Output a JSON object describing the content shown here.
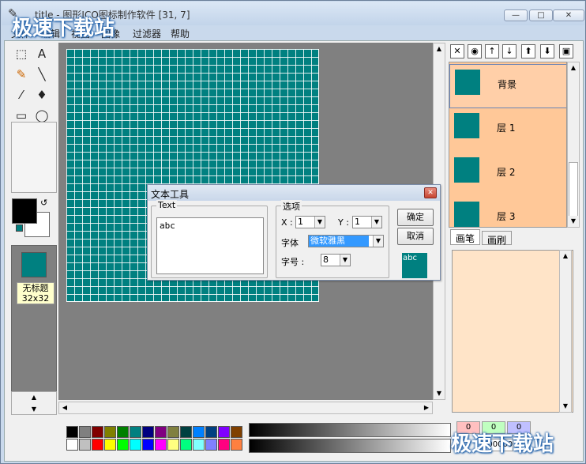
{
  "window": {
    "title": "title - 图形ICO图标制作软件 [31, 7]",
    "min_label": "—",
    "max_label": "□",
    "close_label": "✕"
  },
  "watermark": {
    "text": "极速下载站"
  },
  "menu": [
    "文件",
    "编辑",
    "视图",
    "图像",
    "过滤器",
    "帮助"
  ],
  "toolbox": {
    "tools": [
      "select-rect",
      "text",
      "pencil",
      "line",
      "dropper",
      "fill",
      "rect",
      "ellipse"
    ],
    "tool_glyphs": {
      "select-rect": "⬚",
      "text": "A",
      "pencil": "✎",
      "line": "╲",
      "dropper": "⁄",
      "fill": "♦",
      "rect": "▭",
      "ellipse": "◯"
    },
    "swap_glyph": "↺",
    "thumb_label": "无标题",
    "thumb_size": "32x32",
    "foreground_color": "#000000",
    "background_color": "#ffffff",
    "mini_color": "#008080"
  },
  "canvas": {
    "fill_color": "#008080",
    "grid_cells": 32
  },
  "layers": {
    "toolbar_glyphs": [
      "✕",
      "◉",
      "↑",
      "↓",
      "⬆",
      "⬇",
      "▣"
    ],
    "items": [
      {
        "name": "背景",
        "selected": true
      },
      {
        "name": "层 1",
        "selected": false
      },
      {
        "name": "层 2",
        "selected": false
      },
      {
        "name": "层 3",
        "selected": false
      }
    ]
  },
  "tabs": [
    {
      "label": "画笔",
      "active": true
    },
    {
      "label": "画刷",
      "active": false
    }
  ],
  "palette": {
    "row1": [
      "#000000",
      "#808080",
      "#800000",
      "#808000",
      "#008000",
      "#008080",
      "#000080",
      "#800080",
      "#808040",
      "#004040",
      "#0080ff",
      "#004080",
      "#8000ff",
      "#804000"
    ],
    "row2": [
      "#ffffff",
      "#c0c0c0",
      "#ff0000",
      "#ffff00",
      "#00ff00",
      "#00ffff",
      "#0000ff",
      "#ff00ff",
      "#ffff80",
      "#00ff80",
      "#80ffff",
      "#8080ff",
      "#ff0080",
      "#ff8040"
    ]
  },
  "color_readout": {
    "r": "0",
    "g": "0",
    "b": "0",
    "hex": "000000"
  },
  "dialog": {
    "title": "文本工具",
    "close_label": "✕",
    "text_group_label": "Text",
    "text_value": "abc",
    "options_group_label": "选项",
    "x_label": "X :",
    "x_value": "1",
    "y_label": "Y :",
    "y_value": "1",
    "font_label": "字体",
    "font_value": "微软雅黑",
    "size_label": "字号 :",
    "size_value": "8",
    "ok_label": "确定",
    "cancel_label": "取消",
    "preview_text": "abc",
    "preview_color": "#008080"
  }
}
